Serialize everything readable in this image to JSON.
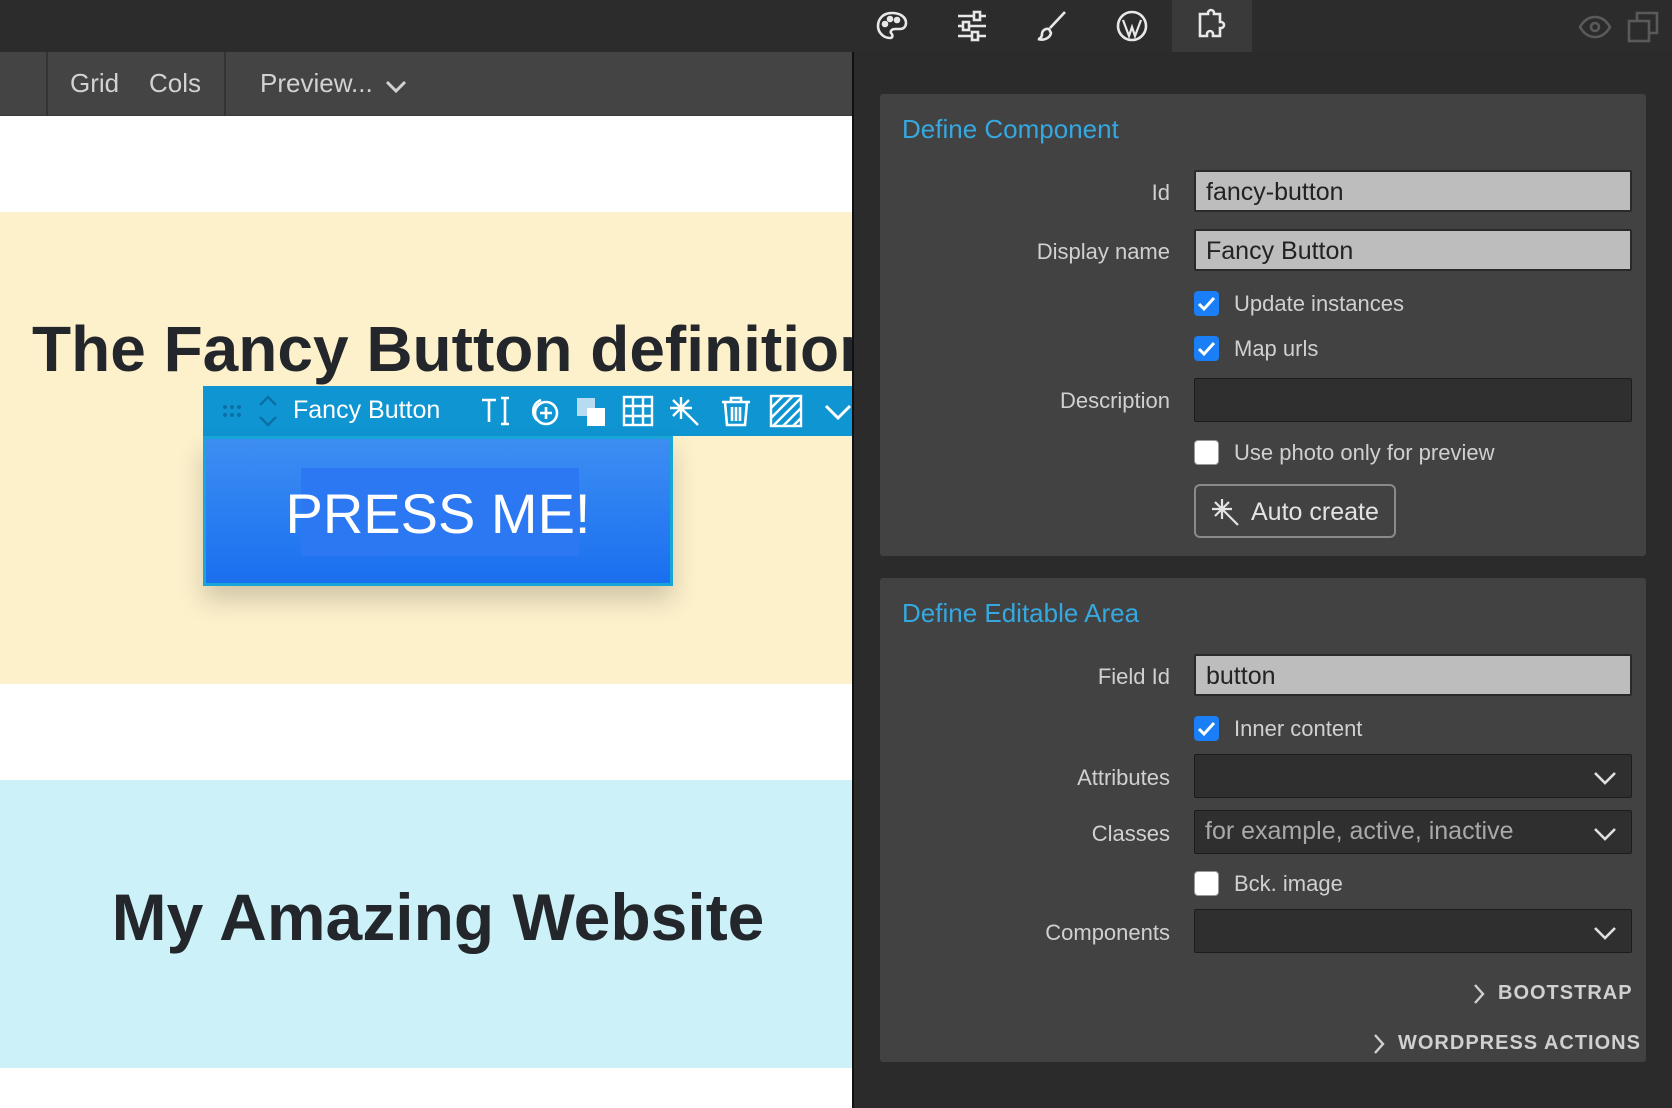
{
  "toolbar": {
    "icons": [
      "palette-icon",
      "sliders-icon",
      "brush-icon",
      "wordpress-icon",
      "puzzle-icon"
    ],
    "right_icons": [
      "eye-icon",
      "duplicate-icon"
    ]
  },
  "canvas": {
    "toolbar": {
      "grid": "Grid",
      "cols": "Cols",
      "preview": "Preview..."
    },
    "heading_fancy": "The Fancy Button definition",
    "selection": {
      "label": "Fancy Button",
      "icons": [
        "drag-handle-icon",
        "move-updown-icon",
        "text-edit-icon",
        "add-circle-icon",
        "layers-icon",
        "grid-icon",
        "magic-icon",
        "trash-icon",
        "pattern-icon",
        "chevron-down-icon"
      ]
    },
    "button_text": "PRESS ME!",
    "heading_site": "My Amazing Website"
  },
  "define_component": {
    "title": "Define Component",
    "id_label": "Id",
    "id_value": "fancy-button",
    "display_name_label": "Display name",
    "display_name_value": "Fancy Button",
    "update_instances": {
      "label": "Update instances",
      "checked": true
    },
    "map_urls": {
      "label": "Map urls",
      "checked": true
    },
    "description_label": "Description",
    "description_value": "",
    "photo_preview": {
      "label": "Use photo only for preview",
      "checked": false
    },
    "auto_create": "Auto create"
  },
  "define_editable": {
    "title": "Define Editable Area",
    "field_id_label": "Field Id",
    "field_id_value": "button",
    "inner_content": {
      "label": "Inner content",
      "checked": true
    },
    "attributes_label": "Attributes",
    "attributes_value": "",
    "classes_label": "Classes",
    "classes_placeholder": "for example, active, inactive",
    "bck_image": {
      "label": "Bck. image",
      "checked": false
    },
    "components_label": "Components",
    "components_value": "",
    "bootstrap": "BOOTSTRAP",
    "wordpress_actions": "WORDPRESS ACTIONS"
  },
  "colors": {
    "accent": "#35a8e0",
    "checkbox": "#1a7ff6",
    "selection_toolbar": "#0f95d2",
    "button": "#1a6ff0",
    "band_yellow": "#fdf1cc",
    "band_blue": "#cdf1f8"
  }
}
